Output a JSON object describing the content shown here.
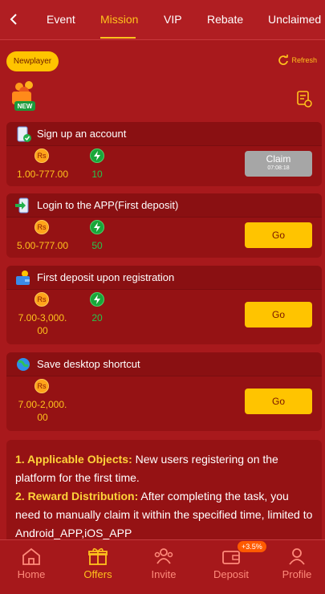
{
  "header": {
    "tabs": [
      {
        "label": "Event"
      },
      {
        "label": "Mission"
      },
      {
        "label": "VIP"
      },
      {
        "label": "Rebate"
      },
      {
        "label": "Unclaimed"
      }
    ],
    "active_tab": "Mission"
  },
  "filter": {
    "newplayer_label": "Newplayer",
    "refresh_label": "Refresh"
  },
  "new_badge_text": "NEW",
  "tasks": [
    {
      "title": "Sign up an account",
      "currency": "Rs",
      "amount": "1.00-777.00",
      "points": "10",
      "button": "Claim",
      "timer": "07:08:18"
    },
    {
      "title": "Login to the APP(First deposit)",
      "currency": "Rs",
      "amount": "5.00-777.00",
      "points": "50",
      "button": "Go"
    },
    {
      "title": "First deposit upon registration",
      "currency": "Rs",
      "amount_line1": "7.00-3,000.",
      "amount_line2": "00",
      "points": "20",
      "button": "Go"
    },
    {
      "title": "Save desktop shortcut",
      "currency": "Rs",
      "amount_line1": "7.00-2,000.",
      "amount_line2": "00",
      "button": "Go"
    }
  ],
  "rules": {
    "item1_key": "1. Applicable Objects:",
    "item1_text": " New users registering on the platform for the first time.",
    "item2_key": "2. Reward Distribution:",
    "item2_text": " After completing the task, you need to manually claim it within the specified time, limited to Android_APP,iOS_APP"
  },
  "bottom_nav": {
    "items": [
      {
        "label": "Home"
      },
      {
        "label": "Offers"
      },
      {
        "label": "Invite"
      },
      {
        "label": "Deposit"
      },
      {
        "label": "Profile"
      }
    ],
    "deposit_tag": "+3.5%"
  },
  "colors": {
    "accent": "#ffc21c",
    "background": "#a8191c",
    "card": "#951214",
    "points": "#27c64d"
  }
}
